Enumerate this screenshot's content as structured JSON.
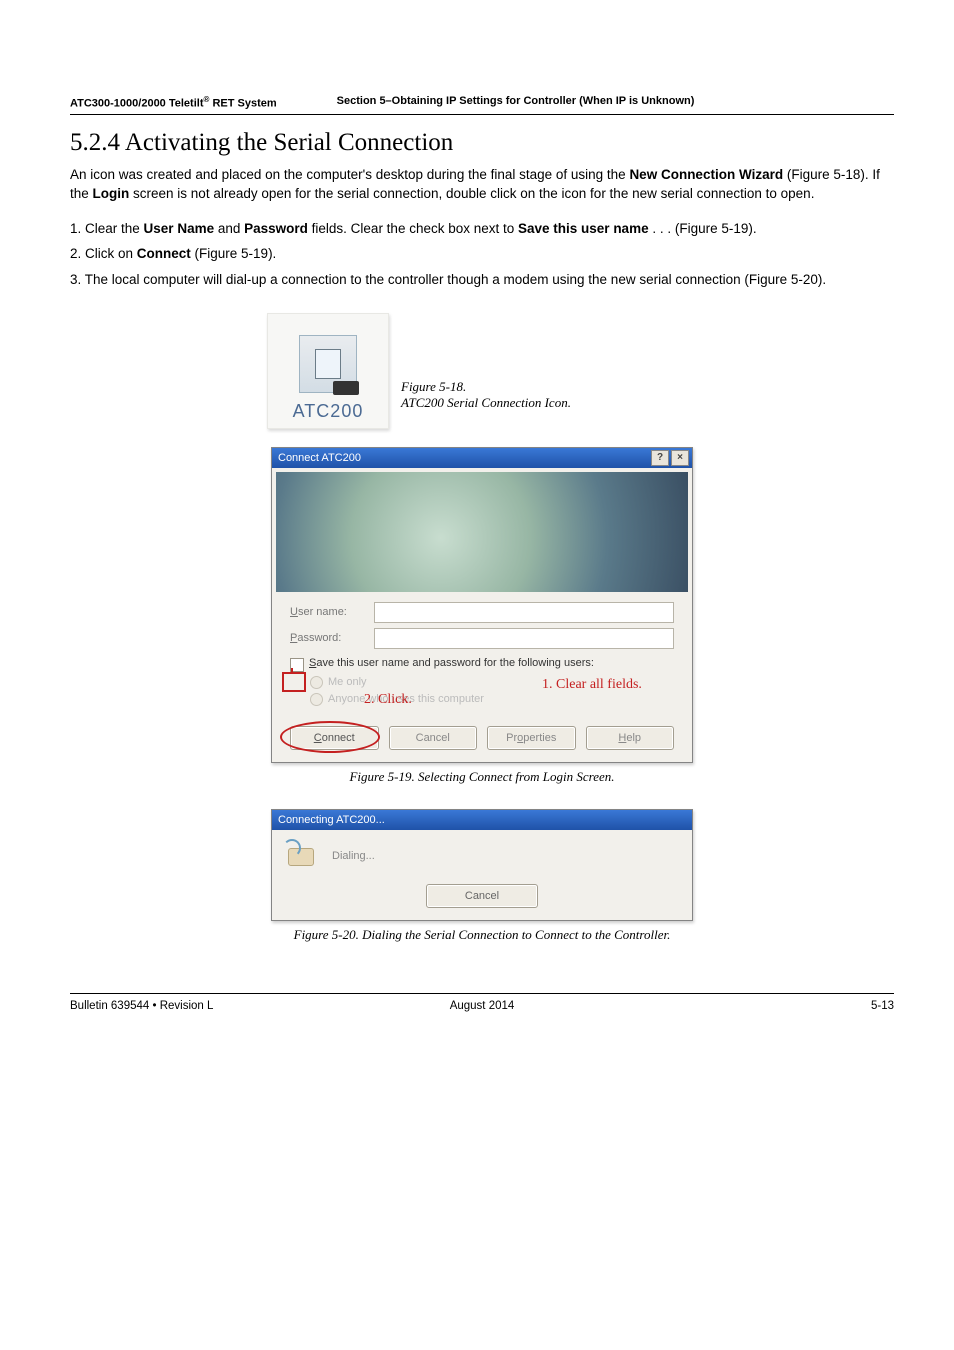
{
  "header": {
    "product": "ATC300-1000/2000 Teletilt",
    "reg": "®",
    "suffix": " RET System",
    "section": "Section 5–Obtaining IP Settings for Controller (When IP is Unknown)"
  },
  "title": "5.2.4 Activating the Serial Connection",
  "intro": {
    "t1": "An icon was created and placed on the computer's desktop during the final stage of using the ",
    "b1": "New Connection Wizard",
    "t2": " (Figure 5-18). If the ",
    "b2": "Login",
    "t3": " screen is not already open for the serial connection, double click on the icon for the new serial connection to open."
  },
  "steps": {
    "s1a": "1. Clear the ",
    "s1b1": "User Name",
    "s1c": " and ",
    "s1b2": "Password",
    "s1d": " fields. Clear the check box next to ",
    "s1b3": "Save this user name",
    "s1e": " . . . (Figure 5-19).",
    "s2a": "2. Click on ",
    "s2b": "Connect",
    "s2c": " (Figure 5-19).",
    "s3": "3. The local computer will dial-up a connection to the controller though a modem using the new serial connection (Figure 5-20)."
  },
  "fig18": {
    "icon_label": "ATC200",
    "caption_a": "Figure 5-18.",
    "caption_b": "ATC200 Serial Connection Icon."
  },
  "fig19": {
    "title": "Connect ATC200",
    "help_btn": "?",
    "close_btn": "×",
    "user_label": "User name:",
    "pass_label": "Password:",
    "save_label": "Save this user name and password for the following users:",
    "radio1": "Me only",
    "radio2": "Anyone who uses this computer",
    "overlay1": "1. Clear all fields.",
    "overlay2": "2. Click.",
    "btn_connect": "Connect",
    "btn_cancel": "Cancel",
    "btn_props": "Properties",
    "btn_help": "Help",
    "caption": "Figure 5-19. Selecting Connect from Login Screen."
  },
  "fig20": {
    "title": "Connecting ATC200...",
    "status": "Dialing...",
    "btn_cancel": "Cancel",
    "caption": "Figure 5-20. Dialing the Serial Connection to Connect to the Controller."
  },
  "footer": {
    "left": "Bulletin 639544  •  Revision L",
    "center": "August 2014",
    "right": "5-13"
  }
}
